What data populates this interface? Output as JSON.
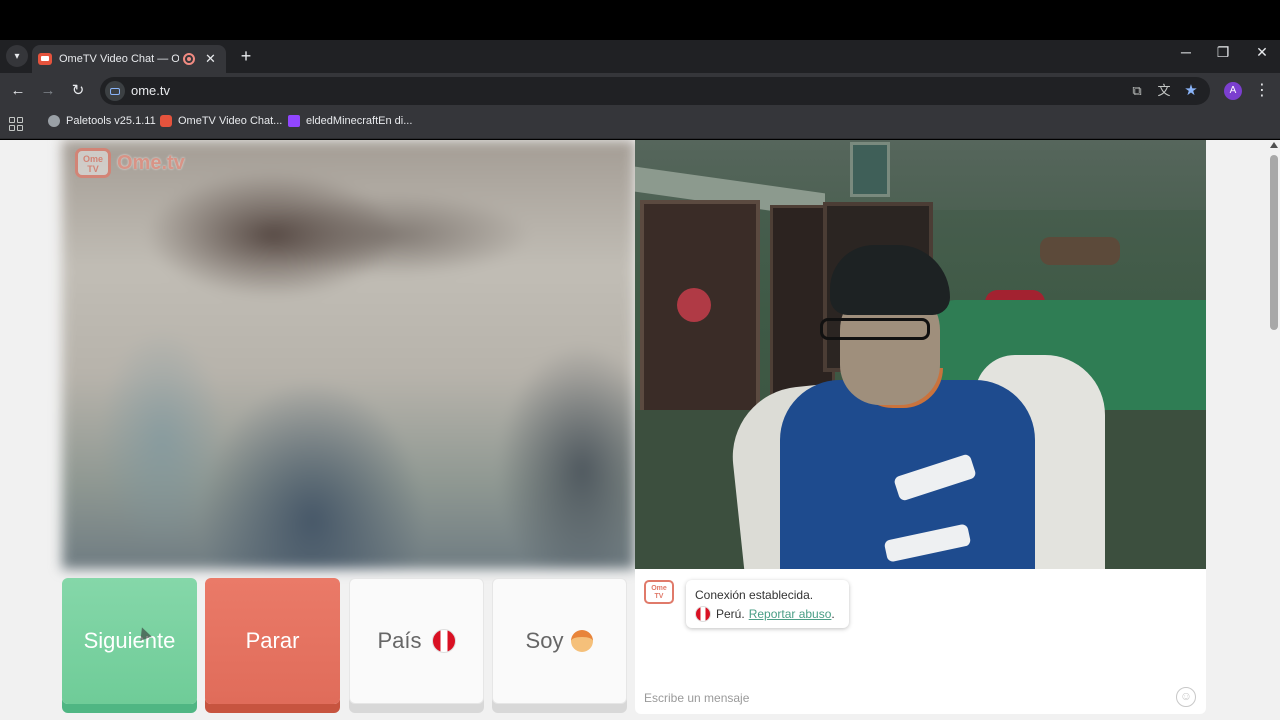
{
  "browser": {
    "tab": {
      "title": "OmeTV Video Chat — Ome"
    },
    "url": "ome.tv",
    "icons": {
      "tab_list": "chevron-down-icon",
      "close": "close-icon",
      "new_tab": "plus-icon",
      "minimize": "minimize-icon",
      "maximize": "maximize-icon",
      "window_close": "window-close-icon",
      "back": "back-arrow-icon",
      "forward": "forward-arrow-icon",
      "reload": "reload-icon",
      "install": "install-app-icon",
      "translate": "translate-icon",
      "bookmark": "star-icon",
      "menu": "kebab-menu-icon"
    },
    "profile_initial": "A",
    "bookmarks": [
      {
        "label": "Paletools v25.1.11",
        "color": "#9aa0a6"
      },
      {
        "label": "OmeTV Video Chat...",
        "color": "#e5533d"
      },
      {
        "label": "eldedMinecraftEn di...",
        "color": "#9146ff"
      }
    ]
  },
  "site": {
    "logo": {
      "badge": "Ome TV",
      "text": "Ome.tv"
    },
    "buttons": {
      "next": "Siguiente",
      "stop": "Parar",
      "country": "País",
      "gender": "Soy"
    },
    "chat": {
      "badge": "Ome TV",
      "status": "Conexión establecida.",
      "country": "Perú.",
      "report": "Reportar abuso",
      "period": ".",
      "placeholder": "Escribe un mensaje"
    }
  },
  "colors": {
    "next": "#6fcc98",
    "stop": "#e06c5a",
    "link": "#4a9e86",
    "brand": "#e07a6a"
  }
}
